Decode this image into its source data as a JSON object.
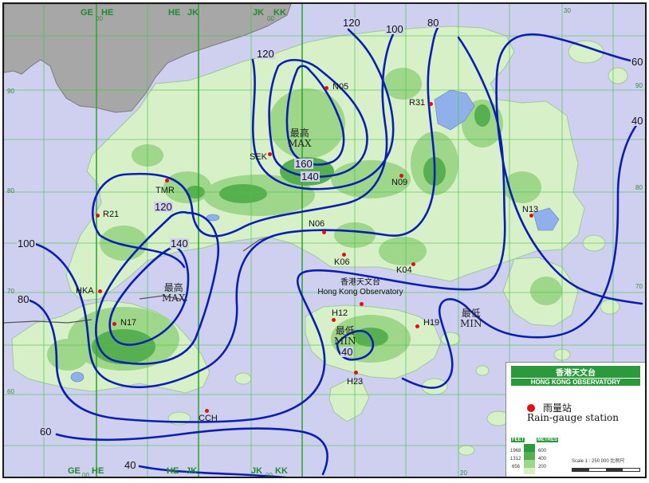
{
  "grid_letters": {
    "top": [
      "GE",
      "HE",
      "HE",
      "JK",
      "JK",
      "KK"
    ],
    "bottom": [
      "GE",
      "HE",
      "HE",
      "JK",
      "JK",
      "KK"
    ],
    "subscripts_top": [
      "00",
      "00"
    ],
    "subscripts_bottom": [
      "00",
      "00"
    ]
  },
  "grid_numbers": {
    "right": [
      "90",
      "80",
      "70",
      "60"
    ],
    "left": [
      "90",
      "80",
      "70",
      "60"
    ],
    "top": [
      "30"
    ],
    "bottom": [
      "20",
      "30"
    ]
  },
  "stations": [
    {
      "code": "N05"
    },
    {
      "code": "R31"
    },
    {
      "code": "SEK"
    },
    {
      "code": "N09"
    },
    {
      "code": "TMR"
    },
    {
      "code": "R21"
    },
    {
      "code": "N13"
    },
    {
      "code": "N06"
    },
    {
      "code": "K06"
    },
    {
      "code": "K04"
    },
    {
      "code": "HKA"
    },
    {
      "code": "N17"
    },
    {
      "code": "H12"
    },
    {
      "code": "H19"
    },
    {
      "code": "H23"
    },
    {
      "code": "CCH"
    }
  ],
  "contour_labels": [
    "120",
    "100",
    "80",
    "60",
    "40",
    "120",
    "160",
    "140",
    "120",
    "100",
    "140",
    "80",
    "40",
    "60",
    "40"
  ],
  "extremes": {
    "max_north": {
      "zh": "最高",
      "en": "MAX"
    },
    "max_west": {
      "zh": "最高",
      "en": "MAX"
    },
    "min_island": {
      "zh": "最低",
      "en": "MIN"
    },
    "min_east": {
      "zh": "最低",
      "en": "MIN"
    }
  },
  "hko": {
    "zh": "香港天文台",
    "en": "Hong Kong Observatory"
  },
  "legend": {
    "org_zh": "香港天文台",
    "org_en": "HONG KONG OBSERVATORY",
    "station_zh": "雨量站",
    "station_en": "Rain-gauge station",
    "feet_head": "FEET",
    "metres_head": "METRES",
    "elev_feet": [
      "1968",
      "1312",
      "656"
    ],
    "elev_metres": [
      "600",
      "400",
      "200"
    ],
    "scale_text": "Scale 1 : 250 000 比例尺"
  },
  "colors": {
    "sea": "#cfd0f0",
    "land_low": "#d8f0c8",
    "land_mid": "#9ed68a",
    "land_high": "#57b04f",
    "mainland": "#a7a7a7",
    "contour": "#0a1eb4",
    "station": "#e01010",
    "grid": "#4cc24c"
  }
}
